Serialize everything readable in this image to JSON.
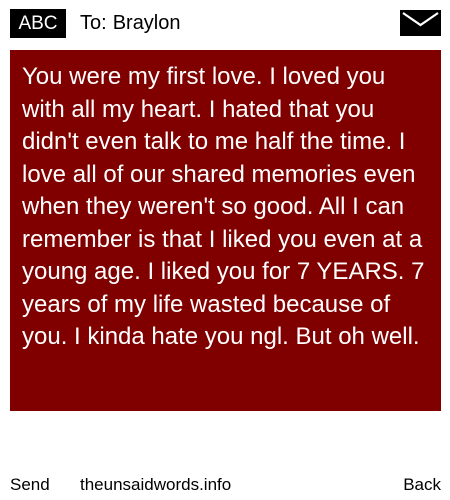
{
  "header": {
    "input_mode": "ABC",
    "to_label": "To:",
    "recipient": "Braylon",
    "envelope_icon": "envelope-icon"
  },
  "message": {
    "text": "You were my first love. I loved you with all my heart. I hated that you didn't even talk to me half the time. I love all of our shared memories even when they weren't so good. All I can remember is that I liked you even at a young age. I liked you for 7 YEARS. 7 years of my life wasted because of you. I kinda hate you ngl. But oh well.",
    "background_color": "#800000",
    "text_color": "#ffffff"
  },
  "footer": {
    "send_label": "Send",
    "site": "theunsaidwords.info",
    "back_label": "Back"
  }
}
